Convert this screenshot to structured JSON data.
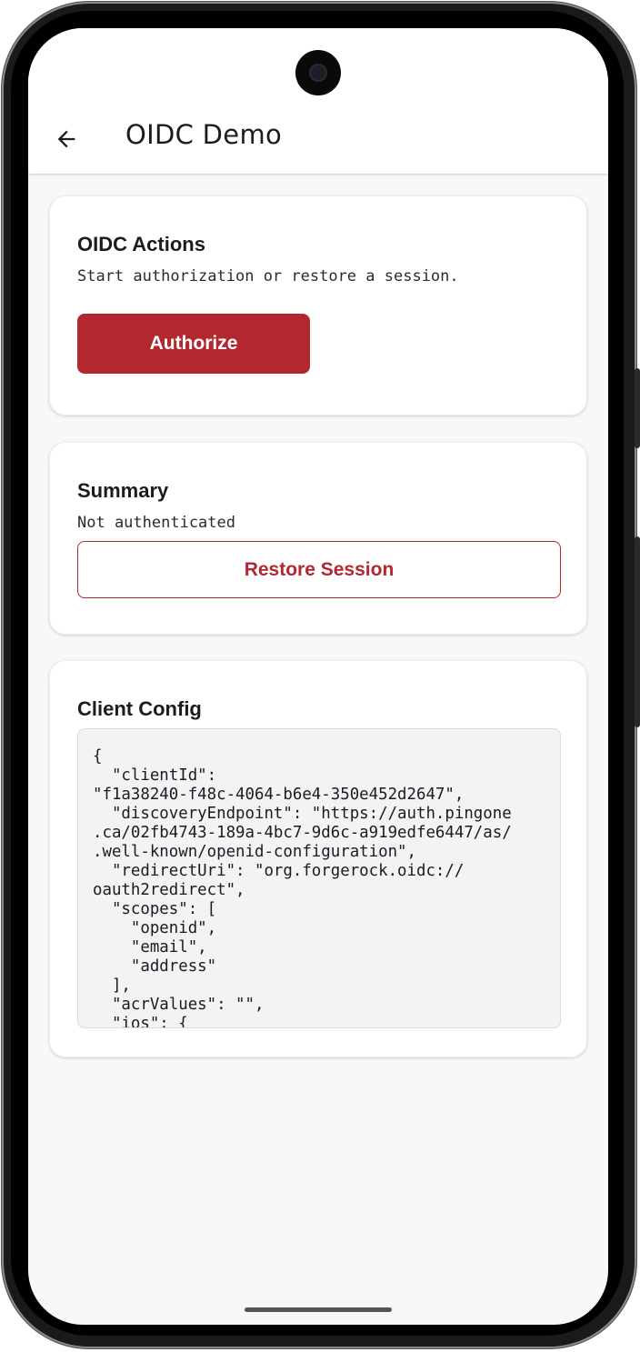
{
  "app_bar": {
    "title": "OIDC Demo",
    "back_icon": "arrow-left-icon"
  },
  "actions_card": {
    "title": "OIDC Actions",
    "subtitle": "Start authorization or restore a session.",
    "authorize_label": "Authorize"
  },
  "summary_card": {
    "title": "Summary",
    "status": "Not authenticated",
    "restore_label": "Restore Session"
  },
  "config_card": {
    "title": "Client Config",
    "code": "{\n  \"clientId\":\n\"f1a38240-f48c-4064-b6e4-350e452d2647\",\n  \"discoveryEndpoint\": \"https://auth.pingone\n.ca/02fb4743-189a-4bc7-9d6c-a919edfe6447/as/\n.well-known/openid-configuration\",\n  \"redirectUri\": \"org.forgerock.oidc://\noauth2redirect\",\n  \"scopes\": [\n    \"openid\",\n    \"email\",\n    \"address\"\n  ],\n  \"acrValues\": \"\",\n  \"ios\": {"
  },
  "colors": {
    "primary": "#b3272e",
    "background": "#f7f8fa",
    "card": "#ffffff",
    "code_bg": "#f4f2f4"
  }
}
